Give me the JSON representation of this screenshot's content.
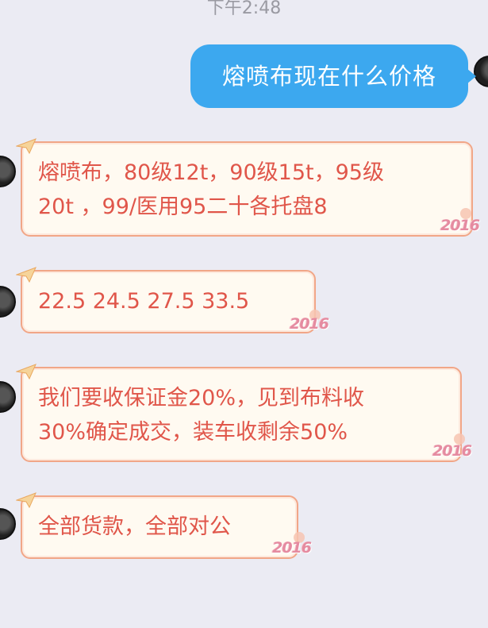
{
  "status": {
    "timestamp": "下午2:48"
  },
  "messages": [
    {
      "direction": "outgoing",
      "text": "熔喷布现在什么价格"
    },
    {
      "direction": "incoming",
      "lines": [
        "熔喷布，80级12t，90级15t，95级",
        "20t ，99/医用95二十各托盘8"
      ]
    },
    {
      "direction": "incoming",
      "lines": [
        "22.5  24.5  27.5  33.5"
      ]
    },
    {
      "direction": "incoming",
      "lines": [
        "我们要收保证金20%，见到布料收",
        "30%确定成交，装车收剩余50%"
      ]
    },
    {
      "direction": "incoming",
      "lines": [
        "全部货款，全部对公"
      ]
    }
  ],
  "decoration": {
    "year_badge": "2016"
  },
  "colors": {
    "background": "#ebebf3",
    "outgoing_bubble": "#3ca8ef",
    "incoming_text": "#e0564a",
    "incoming_border": "#f1a687"
  }
}
